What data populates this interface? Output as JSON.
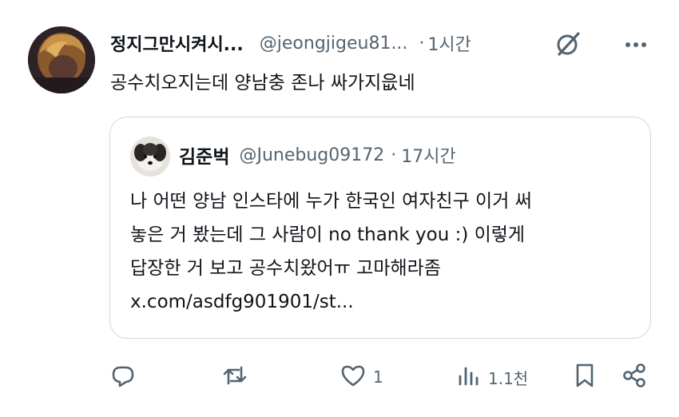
{
  "post": {
    "display_name": "정지그만시켜시...",
    "handle": "@jeongjigeu81...",
    "separator": "·",
    "time": "1시간",
    "text": "공수치오지는데 양남충 존나 싸가지읎네",
    "avatar_icon": "profile-avatar"
  },
  "quote": {
    "display_name": "김준벅",
    "handle": "@Junebug09172",
    "separator": "·",
    "time": "17시간",
    "lines": [
      "나 어떤 양남 인스타에 누가 한국인 여자친구 이거 써",
      "놓은 거 봤는데 그 사람이 no thank you :) 이렇게",
      "답장한 거 보고 공수치왔어ㅠ 고마해라좀",
      "x.com/asdfg901901/st..."
    ],
    "avatar_icon": "dog-avatar"
  },
  "actions": {
    "reply": {
      "icon": "reply-icon",
      "count": ""
    },
    "repost": {
      "icon": "repost-icon",
      "count": ""
    },
    "like": {
      "icon": "heart-icon",
      "count": "1"
    },
    "views": {
      "icon": "views-icon",
      "count": "1.1천"
    },
    "bookmark": {
      "icon": "bookmark-icon"
    },
    "share": {
      "icon": "share-icon"
    }
  },
  "colors": {
    "text": "#0f1419",
    "secondary": "#536471",
    "border": "#cfd9de",
    "background": "#ffffff"
  }
}
